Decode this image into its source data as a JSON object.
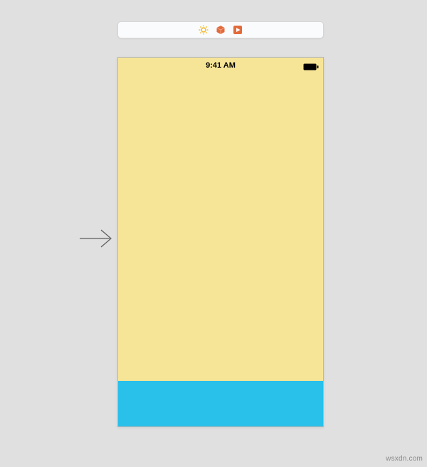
{
  "toolbar": {
    "icons": {
      "sun": {
        "name": "sun-icon",
        "color": "#f3b92b"
      },
      "cube": {
        "name": "cube-icon",
        "color": "#e26a3b"
      },
      "play": {
        "name": "play-in-square-icon",
        "color": "#e26a3b"
      }
    }
  },
  "device": {
    "status": {
      "time": "9:41 AM",
      "battery_level": "full"
    },
    "colors": {
      "background": "#f7e597",
      "bottom_panel": "#29c0ea"
    }
  },
  "arrow": {
    "label": "flow-arrow"
  },
  "watermark": "wsxdn.com"
}
